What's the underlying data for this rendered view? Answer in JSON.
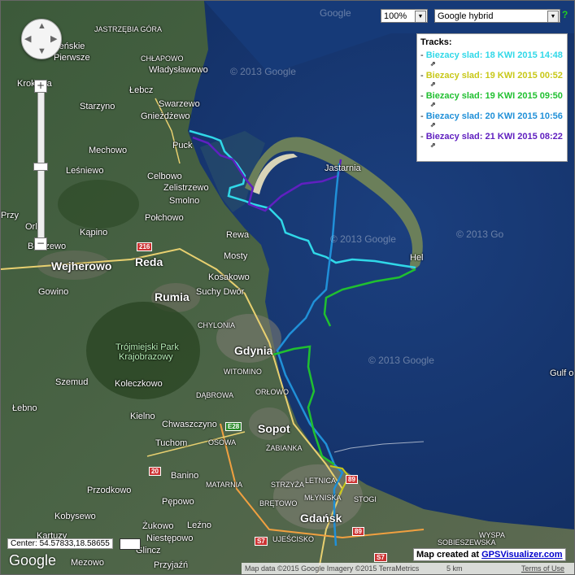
{
  "controls": {
    "zoom_value": "100%",
    "maptype_value": "Google hybrid",
    "help": "?",
    "zoom_in": "+",
    "zoom_out": "−"
  },
  "tracks": {
    "title": "Tracks:",
    "items": [
      {
        "label": "Biezacy slad: 18 KWI 2015 14:48",
        "color": "#30d8e8"
      },
      {
        "label": "Biezacy slad: 19 KWI 2015 00:52",
        "color": "#c8c818"
      },
      {
        "label": "Biezacy slad: 19 KWI 2015 09:50",
        "color": "#20c030"
      },
      {
        "label": "Biezacy slad: 20 KWI 2015 10:56",
        "color": "#2090d8"
      },
      {
        "label": "Biezacy slad: 21 KWI 2015 08:22",
        "color": "#6020c0"
      }
    ],
    "ext_glyph": "⇗"
  },
  "places": [
    {
      "name": "JASTRZĘBIA GÓRA",
      "cls": "small"
    },
    {
      "name": "CHŁAPOWO",
      "cls": "small"
    },
    {
      "name": "Władysławowo",
      "cls": ""
    },
    {
      "name": "Łebcz",
      "cls": ""
    },
    {
      "name": "Swarzewo",
      "cls": ""
    },
    {
      "name": "Starzyno",
      "cls": ""
    },
    {
      "name": "Gnieżdżewo",
      "cls": ""
    },
    {
      "name": "Puck",
      "cls": ""
    },
    {
      "name": "Mechowo",
      "cls": ""
    },
    {
      "name": "Leśniewo",
      "cls": ""
    },
    {
      "name": "Celbowo",
      "cls": ""
    },
    {
      "name": "Zelistrzewo",
      "cls": ""
    },
    {
      "name": "Smolno",
      "cls": ""
    },
    {
      "name": "Połchowo",
      "cls": ""
    },
    {
      "name": "Kąpino",
      "cls": ""
    },
    {
      "name": "Rewa",
      "cls": ""
    },
    {
      "name": "Mosty",
      "cls": ""
    },
    {
      "name": "Reda",
      "cls": "big"
    },
    {
      "name": "Wejherowo",
      "cls": "big"
    },
    {
      "name": "Kosakowo",
      "cls": ""
    },
    {
      "name": "Suchy Dwór",
      "cls": ""
    },
    {
      "name": "Gowino",
      "cls": ""
    },
    {
      "name": "Rumia",
      "cls": "big"
    },
    {
      "name": "CHYLONIA",
      "cls": "small"
    },
    {
      "name": "Gdynia",
      "cls": "big"
    },
    {
      "name": "Trójmiejski Park",
      "cls": "park"
    },
    {
      "name": "Krajobrazowy",
      "cls": "park"
    },
    {
      "name": "WITOMINO",
      "cls": "small"
    },
    {
      "name": "Szemud",
      "cls": ""
    },
    {
      "name": "Koleczkowo",
      "cls": ""
    },
    {
      "name": "ORŁOWO",
      "cls": "small"
    },
    {
      "name": "DĄBROWA",
      "cls": "small"
    },
    {
      "name": "Łebno",
      "cls": ""
    },
    {
      "name": "Kielno",
      "cls": ""
    },
    {
      "name": "Sopot",
      "cls": "big"
    },
    {
      "name": "Chwaszczyno",
      "cls": ""
    },
    {
      "name": "OSOWA",
      "cls": "small"
    },
    {
      "name": "Tuchom",
      "cls": ""
    },
    {
      "name": "ŻABIANKA",
      "cls": "small"
    },
    {
      "name": "Banino",
      "cls": ""
    },
    {
      "name": "MATARNIA",
      "cls": "small"
    },
    {
      "name": "STRZYŻA",
      "cls": "small"
    },
    {
      "name": "LETNICA",
      "cls": "small"
    },
    {
      "name": "Przodkowo",
      "cls": ""
    },
    {
      "name": "Pępowo",
      "cls": ""
    },
    {
      "name": "MŁYNISKA",
      "cls": "small"
    },
    {
      "name": "STOGI",
      "cls": "small"
    },
    {
      "name": "BRĘTOWO",
      "cls": "small"
    },
    {
      "name": "Gdańsk",
      "cls": "big"
    },
    {
      "name": "Kobysewo",
      "cls": ""
    },
    {
      "name": "Żukowo",
      "cls": ""
    },
    {
      "name": "Leźno",
      "cls": ""
    },
    {
      "name": "UJEŚCISKO",
      "cls": "small"
    },
    {
      "name": "Niestępowo",
      "cls": ""
    },
    {
      "name": "Glincz",
      "cls": ""
    },
    {
      "name": "Mezowo",
      "cls": ""
    },
    {
      "name": "Przyjaźń",
      "cls": ""
    },
    {
      "name": "Jastarnia",
      "cls": ""
    },
    {
      "name": "Hel",
      "cls": ""
    },
    {
      "name": "Gulf o",
      "cls": ""
    },
    {
      "name": "WYSPA",
      "cls": "small"
    },
    {
      "name": "SOBIESZEWSKA",
      "cls": "small"
    },
    {
      "name": "Krokowa",
      "cls": ""
    },
    {
      "name": "Orle",
      "cls": ""
    },
    {
      "name": "Bolszewo",
      "cls": ""
    },
    {
      "name": "Pierwsze",
      "cls": ""
    },
    {
      "name": "Mieńskie",
      "cls": ""
    },
    {
      "name": "Kartuzy",
      "cls": ""
    },
    {
      "name": "Przy",
      "cls": ""
    }
  ],
  "watermarks": [
    "© 2013 Google",
    "© 2013 Google",
    "© 2013 Go",
    "© 2013 Google",
    "Google"
  ],
  "roads": [
    "216",
    "E28",
    "20",
    "S7",
    "S7",
    "89",
    "89"
  ],
  "bottom": {
    "center": "Center: 54.57833,18.58655",
    "google": "Google",
    "created_prefix": "Map created at ",
    "created_link": "GPSVisualizer.com",
    "attribution": "Map data ©2015 Google Imagery ©2015 TerraMetrics",
    "scale": "5 km",
    "terms": "Terms of Use"
  }
}
